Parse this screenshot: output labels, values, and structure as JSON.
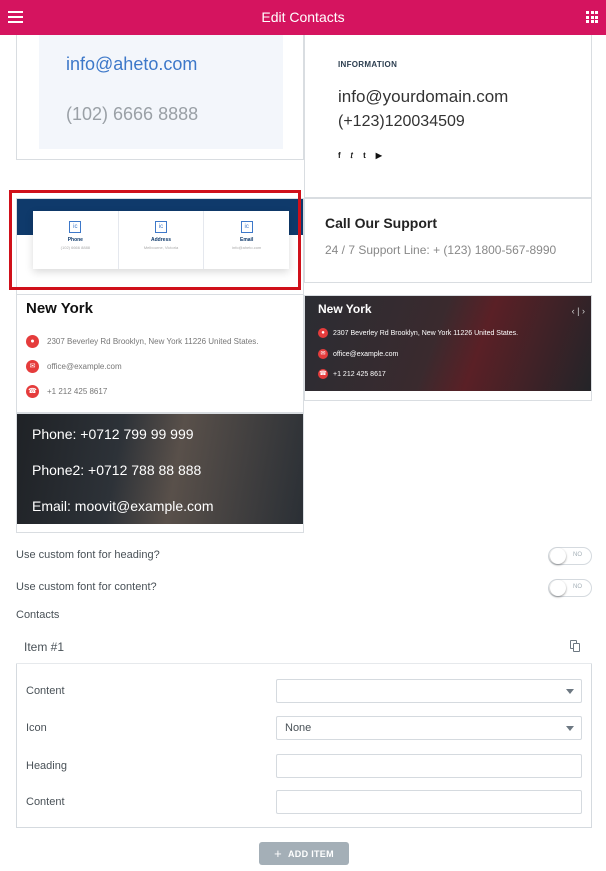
{
  "header": {
    "title": "Edit Contacts"
  },
  "previews": {
    "p1": {
      "email": "info@aheto.com",
      "phone": "(102) 6666 8888"
    },
    "p2": {
      "label": "INFORMATION",
      "email": "info@yourdomain.com",
      "phone": "(+123)120034509",
      "social": [
        "f",
        "tw",
        "t",
        "yt"
      ]
    },
    "p3": {
      "columns": [
        {
          "title": "Phone",
          "sub": "(102) 6666 8888"
        },
        {
          "title": "Address",
          "sub": "Melbourne, Victoria"
        },
        {
          "title": "Email",
          "sub": "info@aheto.com"
        }
      ]
    },
    "p4": {
      "heading": "Call Our Support",
      "sub": "24 / 7 Support Line: + (123) 1800-567-8990"
    },
    "p5": {
      "heading": "New York",
      "address": "2307 Beverley Rd Brooklyn, New York 11226 United States.",
      "email": "office@example.com",
      "phone": "+1 212 425 8617"
    },
    "p6": {
      "heading": "New York",
      "address": "2307 Beverley Rd Brooklyn, New York 11226 United States.",
      "email": "office@example.com",
      "phone": "+1 212 425 8617"
    },
    "p7": {
      "phone": "Phone: +0712 799 99 999",
      "phone2": "Phone2: +0712 788 88 888",
      "email": "Email: moovit@example.com"
    }
  },
  "controls": {
    "custom_heading_label": "Use custom font for heading?",
    "custom_content_label": "Use custom font for content?",
    "toggle_off_text": "NO",
    "contacts_label": "Contacts"
  },
  "item": {
    "title": "Item #1",
    "fields": {
      "content_label": "Content",
      "icon_label": "Icon",
      "icon_value": "None",
      "heading_label": "Heading",
      "content2_label": "Content"
    }
  },
  "add_item_label": "ADD ITEM",
  "colors": {
    "brand": "#d5145f",
    "selection": "#d0101a"
  }
}
